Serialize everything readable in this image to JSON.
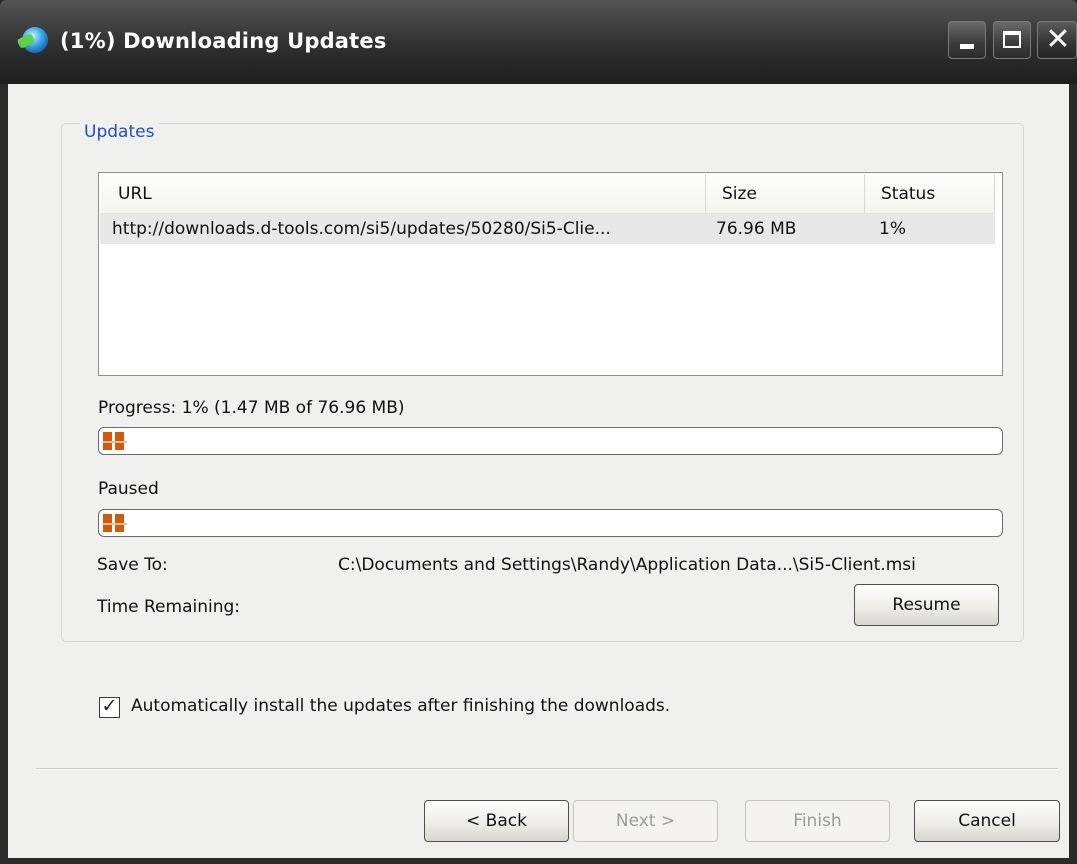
{
  "window": {
    "title": "(1%) Downloading Updates",
    "icon": "app-globe-icon",
    "controls": {
      "minimize_icon": "minimize-icon",
      "maximize_icon": "maximize-icon",
      "close_icon": "close-icon"
    }
  },
  "updates_group": {
    "label": "Updates",
    "columns": [
      "URL",
      "Size",
      "Status"
    ],
    "rows": [
      {
        "url": "http://downloads.d-tools.com/si5/updates/50280/Si5-Clie...",
        "size": "76.96 MB",
        "status": "1%"
      }
    ]
  },
  "progress": {
    "label": "Progress: 1% (1.47 MB of 76.96 MB)",
    "value_percent": 1
  },
  "state": {
    "label": "Paused",
    "value_percent": 1
  },
  "save_to": {
    "label": "Save To:",
    "value": "C:\\Documents and Settings\\Randy\\Application Data...\\Si5-Client.msi"
  },
  "time_remaining": {
    "label": "Time Remaining:",
    "value": ""
  },
  "resume_button": "Resume",
  "auto_install": {
    "checked": true,
    "label": "Automatically install the updates after finishing the downloads."
  },
  "nav": {
    "back": "< Back",
    "next": "Next >",
    "finish": "Finish",
    "cancel": "Cancel"
  },
  "colors": {
    "titlebar": "#2f2f2f",
    "group_label": "#1b4fd0",
    "progress_fill": "#cf5a12"
  }
}
